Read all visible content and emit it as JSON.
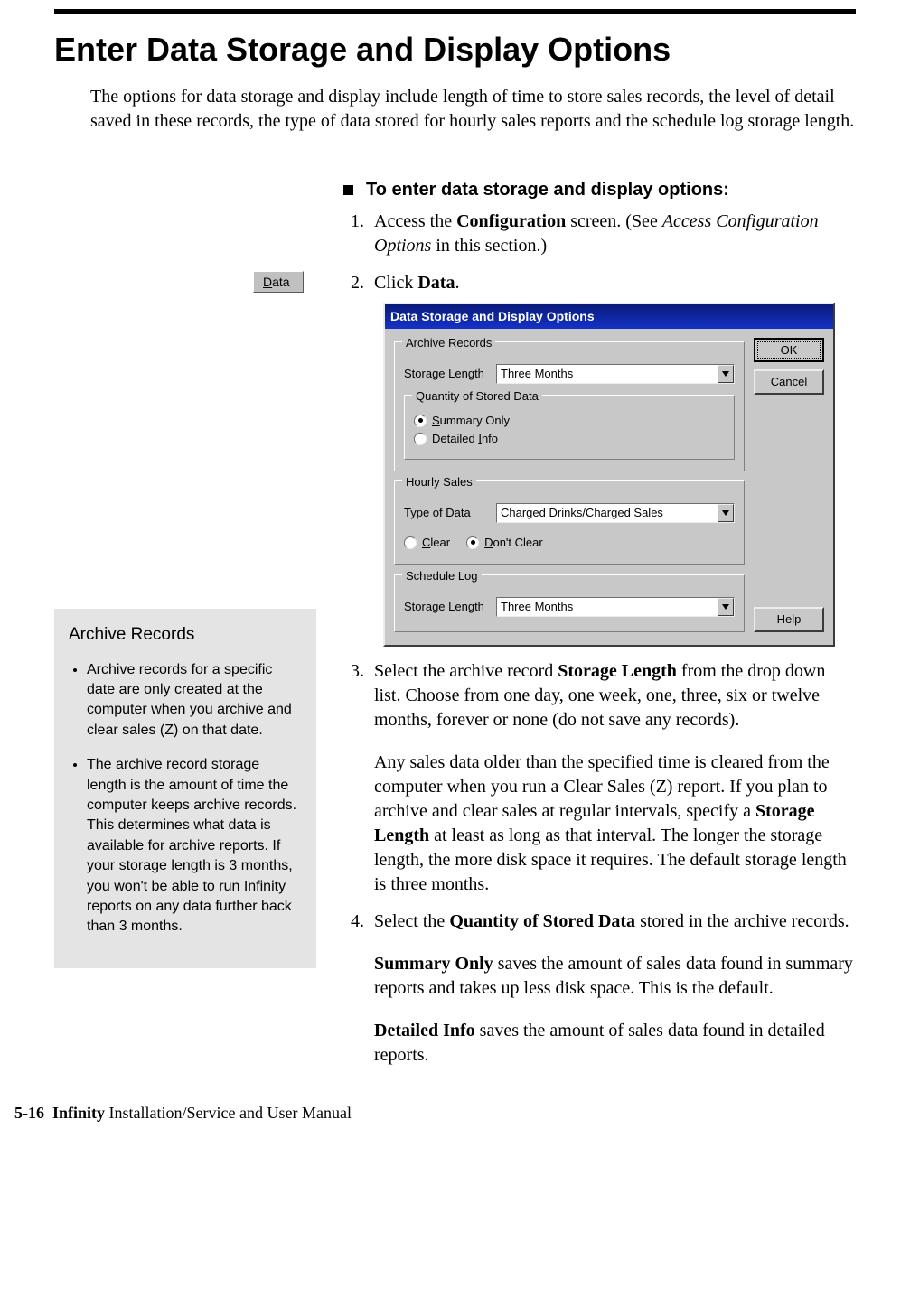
{
  "heading": "Enter Data Storage and Display Options",
  "intro": "The options for data storage and display include length of time to store sales records, the level of detail saved in these records, the type of data stored for hourly sales reports and the schedule log storage length.",
  "proc_heading": "To enter data storage and display options:",
  "data_button_char": "D",
  "data_button_rest": "ata",
  "steps": {
    "s1_a": "Access the ",
    "s1_b": "Configuration",
    "s1_c": " screen. (See ",
    "s1_d": "Access Configuration Options",
    "s1_e": " in this section.)",
    "s2_a": "Click ",
    "s2_b": "Data",
    "s2_c": ".",
    "s3_a": "Select the archive record ",
    "s3_b": "Storage Length",
    "s3_c": " from the drop down list. Choose from one day, one week, one, three, six or twelve months, forever or none (do not save any records).",
    "s3_p2_a": "Any sales data older than the specified time is cleared from the computer when you run a Clear Sales (Z) report. If you plan to archive and clear sales at regular intervals, specify a ",
    "s3_p2_b": "Storage Length",
    "s3_p2_c": " at least as long as that interval. The longer the storage length, the more disk space it requires. The default storage length is three months.",
    "s4_a": "Select the ",
    "s4_b": "Quantity of Stored Data",
    "s4_c": " stored in the archive records.",
    "s4_p2_a": "Summary Only",
    "s4_p2_b": " saves the amount of sales data found in summary reports and takes up less disk space. This is the default.",
    "s4_p3_a": "Detailed Info",
    "s4_p3_b": " saves the amount of sales data found in detailed reports."
  },
  "dialog": {
    "title": "Data Storage and Display Options",
    "archive_legend": "Archive Records",
    "storage_length_label": "Storage Length",
    "storage_length_value": "Three Months",
    "qty_legend": "Quantity of Stored Data",
    "summary_u": "S",
    "summary_rest": "ummary Only",
    "detailed_pre": "Detailed ",
    "detailed_u": "I",
    "detailed_rest": "nfo",
    "hourly_legend": "Hourly Sales",
    "type_label": "Type of Data",
    "type_value": "Charged Drinks/Charged Sales",
    "clear_u": "C",
    "clear_rest": "lear",
    "dont_u": "D",
    "dont_rest": "on't Clear",
    "sched_legend": "Schedule Log",
    "sched_label": "Storage Length",
    "sched_value": "Three Months",
    "ok": "OK",
    "cancel": "Cancel",
    "help": "Help"
  },
  "sidebar": {
    "title": "Archive Records",
    "bullet1": "Archive records for a specific date are only created at the computer when you archive and clear sales (Z) on that date.",
    "bullet2": "The archive record storage length is the amount of time the computer keeps archive records. This determines what data is available for archive reports. If your storage length is 3 months, you won't be able to run Infinity reports on any data further back than 3 months."
  },
  "footer_page": "5-16",
  "footer_bold": "Infinity",
  "footer_rest": " Installation/Service and User Manual"
}
